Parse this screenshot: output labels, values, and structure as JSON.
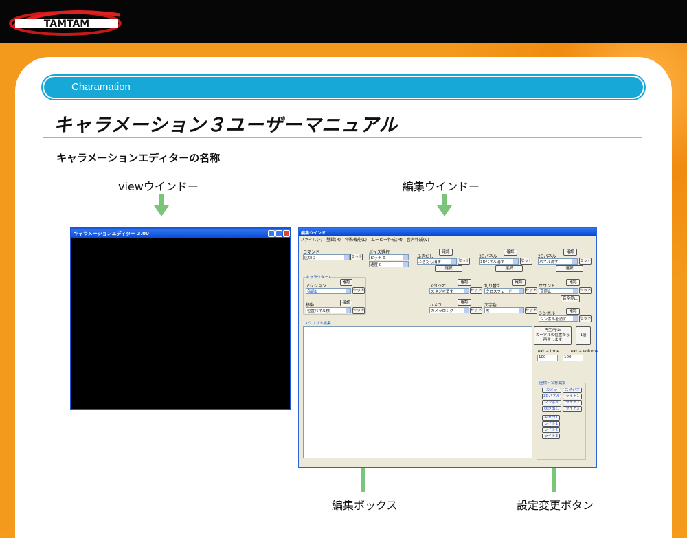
{
  "header": {
    "logo_text": "TAMTAM"
  },
  "section": {
    "label": "Charamation"
  },
  "page": {
    "title": "キャラメーション３ユーザーマニュアル",
    "subtitle": "キャラメーションエディターの名称"
  },
  "labels": {
    "view_window": "viewウインドー",
    "edit_window": "編集ウインドー",
    "edit_box": "編集ボックス",
    "settings_button": "設定変更ボタン"
  },
  "view_window": {
    "title": "キャラメーションエディター 3.00"
  },
  "edit_window": {
    "title": "編集ウインド",
    "menu": [
      "ファイル(F)",
      "登録(R)",
      "特殊機能(L)",
      "ムービー作成(M)",
      "音声作成(V)"
    ],
    "command": {
      "label": "コマンド",
      "value": "区切り",
      "button": "セット"
    },
    "voice": {
      "label": "ボイス選択",
      "pitch": "ピッチ 0",
      "speed": "速度 0"
    },
    "fukidashi": {
      "label": "ふきだし",
      "confirm": "確認",
      "value": "ふきだし消す",
      "button": "セット",
      "select": "選択"
    },
    "panel3d": {
      "label": "3Dパネル",
      "confirm": "確認",
      "value": "3Dパネル消す",
      "button": "セット",
      "select": "選択"
    },
    "panel2d": {
      "label": "2Dパネル",
      "confirm": "確認",
      "value": "パネル消す",
      "button": "セット",
      "select": "選択"
    },
    "character": {
      "group": "キャラクター1",
      "action_label": "アクション",
      "action_confirm": "確認",
      "action_value": "名前1",
      "action_button": "セット",
      "move_label": "移動",
      "move_confirm": "確認",
      "move_value": "位置パネル横",
      "move_button": "セット"
    },
    "studio": {
      "label": "スタジオ",
      "confirm": "確認",
      "value": "スタジオ消す",
      "button": "セット"
    },
    "switch": {
      "label": "切り替え",
      "confirm": "確認",
      "value": "クロスフェード",
      "button": "セット"
    },
    "sound": {
      "label": "サウンド",
      "confirm": "確認",
      "value": "音停止",
      "button": "セット",
      "stop_all": "音全停止"
    },
    "camera": {
      "label": "カメラ",
      "confirm": "確認",
      "value": "カメラロング",
      "button": "セット"
    },
    "textcolor": {
      "label": "文字色",
      "value": "黒",
      "button": "セット"
    },
    "symbol": {
      "label": "シンボル",
      "confirm": "確認",
      "value": "シンボルを消す",
      "button": "セット"
    },
    "script": {
      "label": "スクリプト編集"
    },
    "playback": {
      "play_line1": "再生/停止",
      "play_line2": "カーソルの位置から",
      "play_line3": "再生します",
      "speed": "1倍"
    },
    "extra": {
      "tone_label": "extra tone",
      "tone_value": "100",
      "volume_label": "extra volume",
      "volume_value": "100"
    },
    "coords": {
      "group": "座標・名称編集",
      "buttons": [
        "カメラ",
        "スタジオ",
        "3Dパネル",
        "ライト1",
        "シンボル",
        "ライト2",
        "吹き出し",
        "ライト3"
      ],
      "buttons2": [
        "キャラ1",
        "ライト1",
        "ライト2",
        "ライト3"
      ]
    }
  },
  "colors": {
    "accent": "#18a8d8",
    "arrow": "#7ac57a",
    "orange": "#f59a1a"
  }
}
